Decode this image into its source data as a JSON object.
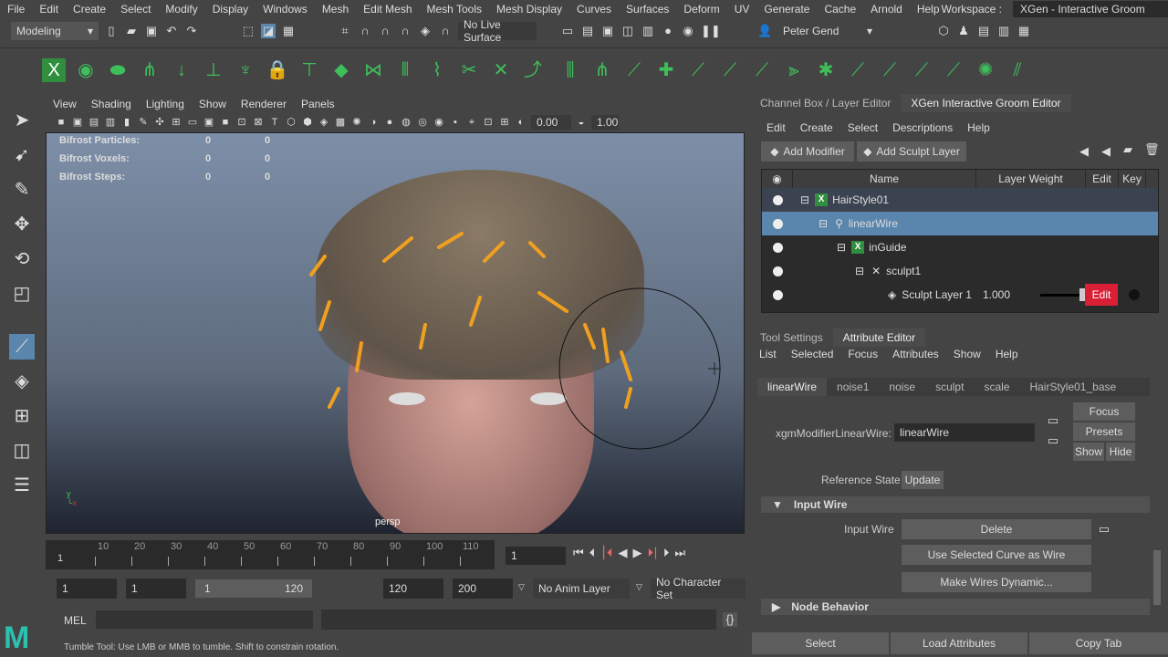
{
  "menu": [
    "File",
    "Edit",
    "Create",
    "Select",
    "Modify",
    "Display",
    "Windows",
    "Mesh",
    "Edit Mesh",
    "Mesh Tools",
    "Mesh Display",
    "Curves",
    "Surfaces",
    "Deform",
    "UV",
    "Generate",
    "Cache",
    "Arnold",
    "Help"
  ],
  "workspace": {
    "label": "Workspace :",
    "value": "XGen - Interactive Groom"
  },
  "status": {
    "mode": "Modeling",
    "live_surface": "No Live Surface",
    "user": "Peter Gend"
  },
  "viewport": {
    "menu": [
      "View",
      "Shading",
      "Lighting",
      "Show",
      "Renderer",
      "Panels"
    ],
    "field1": "0.00",
    "field2": "1.00",
    "camera": "persp",
    "hud": [
      {
        "label": "Bifrost Particles:",
        "a": "0",
        "b": "0"
      },
      {
        "label": "Bifrost Voxels:",
        "a": "0",
        "b": "0"
      },
      {
        "label": "Bifrost Steps:",
        "a": "0",
        "b": "0"
      }
    ]
  },
  "right": {
    "tabs": [
      "Channel Box / Layer Editor",
      "XGen Interactive Groom Editor"
    ],
    "groom_menu": [
      "Edit",
      "Create",
      "Select",
      "Descriptions",
      "Help"
    ],
    "add_modifier": "Add Modifier",
    "add_sculpt": "Add Sculpt Layer",
    "columns": [
      "Name",
      "Layer Weight",
      "Edit",
      "Key"
    ],
    "rows": [
      "HairStyle01",
      "linearWire",
      "inGuide",
      "sculpt1",
      "Sculpt Layer 1"
    ],
    "layer_weight": "1.000",
    "edit": "Edit",
    "lower_tabs": [
      "Tool Settings",
      "Attribute Editor"
    ],
    "ae_menu": [
      "List",
      "Selected",
      "Focus",
      "Attributes",
      "Show",
      "Help"
    ],
    "node_tabs": [
      "linearWire",
      "noise1",
      "noise",
      "sculpt",
      "scale",
      "HairStyle01_base"
    ],
    "node_label": "xgmModifierLinearWire:",
    "node_value": "linearWire",
    "focus": "Focus",
    "presets": "Presets",
    "show": "Show",
    "hide": "Hide",
    "ref_state": "Reference State",
    "update": "Update",
    "input_wire_section": "Input Wire",
    "input_wire_label": "Input Wire",
    "delete": "Delete",
    "use_curve": "Use Selected Curve as Wire",
    "make_dynamic": "Make Wires Dynamic...",
    "node_behavior": "Node Behavior",
    "bottom": [
      "Select",
      "Load Attributes",
      "Copy Tab"
    ]
  },
  "timeline": {
    "ticks": [
      "10",
      "20",
      "30",
      "40",
      "50",
      "60",
      "70",
      "80",
      "90",
      "100",
      "110"
    ],
    "start_label": "1",
    "current": "1"
  },
  "range": {
    "start": "1",
    "inner_start": "1",
    "slider_start": "1",
    "slider_end": "120",
    "inner_end": "120",
    "end": "200",
    "anim_layer": "No Anim Layer",
    "char_set": "No Character Set"
  },
  "cmd": {
    "lang": "MEL"
  },
  "help_line": "Tumble Tool: Use LMB or MMB to tumble. Shift to constrain rotation.",
  "colors": {
    "selection": "#5a86ad",
    "edit_red": "#d81f34",
    "hair_guide": "#f0a020"
  }
}
